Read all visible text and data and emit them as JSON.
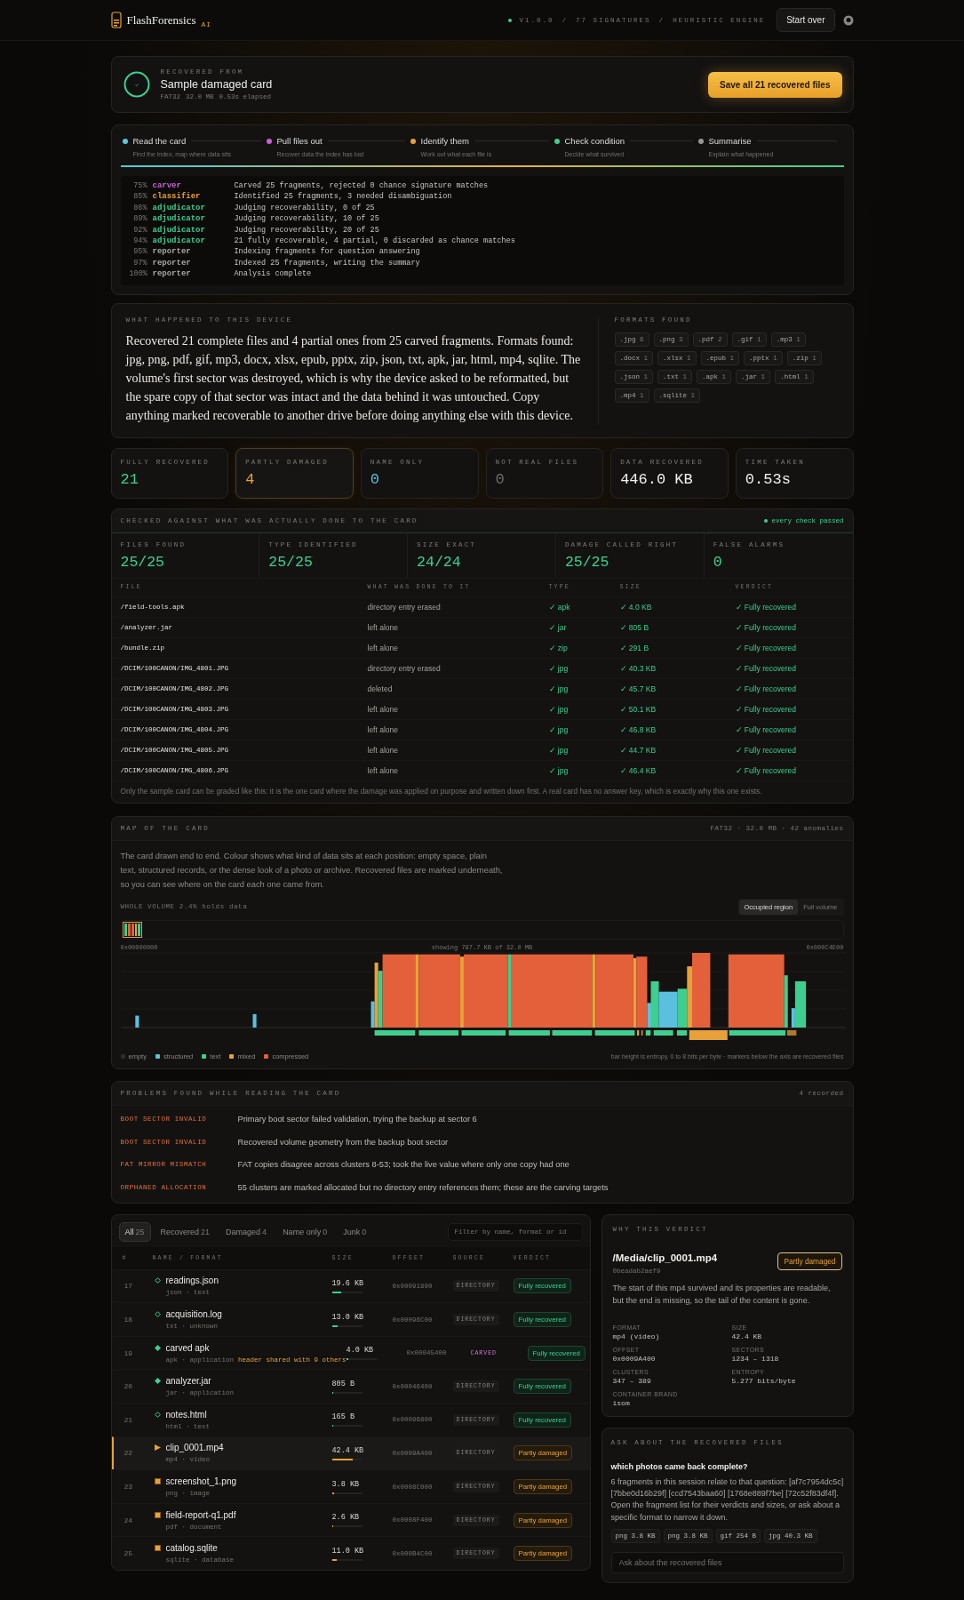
{
  "header": {
    "brand": "FlashForensics",
    "badge": "AI",
    "meta": [
      "V1.0.0",
      "/",
      "77 SIGNATURES",
      "/",
      "HEURISTIC ENGINE"
    ],
    "start_over": "Start over"
  },
  "source": {
    "label": "RECOVERED FROM",
    "name": "Sample damaged card",
    "details": [
      "FAT32",
      "32.0 MB",
      "0.53s elapsed"
    ],
    "save_button": "Save all 21 recovered files"
  },
  "pipeline": {
    "steps": [
      {
        "label": "Read the card",
        "hint": "Find the index, map where data sits",
        "color": "#5bc8e0"
      },
      {
        "label": "Pull files out",
        "hint": "Recover data the index has lost",
        "color": "#c85fd6"
      },
      {
        "label": "Identify them",
        "hint": "Work out what each file is",
        "color": "#e8a13a"
      },
      {
        "label": "Check condition",
        "hint": "Decide what survived",
        "color": "#3ecf8e"
      },
      {
        "label": "Summarise",
        "hint": "Explain what happened",
        "color": "#9a9794"
      }
    ],
    "progress": {
      "level": 1
    },
    "log": [
      {
        "percent": "75%",
        "agent": "carver",
        "message": "Carved 25 fragments, rejected 0 chance signature matches",
        "color": "#c85fd6"
      },
      {
        "percent": "85%",
        "agent": "classifier",
        "message": "Identified 25 fragments, 3 needed disambiguation",
        "color": "#e8a13a"
      },
      {
        "percent": "86%",
        "agent": "adjudicator",
        "message": "Judging recoverability, 0 of 25",
        "color": "#3ecf8e"
      },
      {
        "percent": "89%",
        "agent": "adjudicator",
        "message": "Judging recoverability, 10 of 25",
        "color": "#3ecf8e"
      },
      {
        "percent": "92%",
        "agent": "adjudicator",
        "message": "Judging recoverability, 20 of 25",
        "color": "#3ecf8e"
      },
      {
        "percent": "94%",
        "agent": "adjudicator",
        "message": "21 fully recoverable, 4 partial, 0 discarded as chance matches",
        "color": "#3ecf8e"
      },
      {
        "percent": "95%",
        "agent": "reporter",
        "message": "Indexing fragments for question answering",
        "color": "#a8a5a1"
      },
      {
        "percent": "97%",
        "agent": "reporter",
        "message": "Indexed 25 fragments, writing the summary",
        "color": "#a8a5a1"
      },
      {
        "percent": "100%",
        "agent": "reporter",
        "message": "Analysis complete",
        "color": "#a8a5a1"
      }
    ]
  },
  "summary": {
    "label": "WHAT HAPPENED TO THIS DEVICE",
    "text": "Recovered 21 complete files and 4 partial ones from 25 carved fragments. Formats found: jpg, png, pdf, gif, mp3, docx, xlsx, epub, pptx, zip, json, txt, apk, jar, html, mp4, sqlite. The volume's first sector was destroyed, which is why the device asked to be reformatted, but the spare copy of that sector was intact and the data behind it was untouched. Copy anything marked recoverable to another drive before doing anything else with this device.",
    "formats_label": "FORMATS FOUND",
    "formats": [
      {
        "name": ".jpg",
        "count": "6"
      },
      {
        "name": ".png",
        "count": "3"
      },
      {
        "name": ".pdf",
        "count": "2"
      },
      {
        "name": ".gif",
        "count": "1"
      },
      {
        "name": ".mp3",
        "count": "1"
      },
      {
        "name": ".docx",
        "count": "1"
      },
      {
        "name": ".xlsx",
        "count": "1"
      },
      {
        "name": ".epub",
        "count": "1"
      },
      {
        "name": ".pptx",
        "count": "1"
      },
      {
        "name": ".zip",
        "count": "1"
      },
      {
        "name": ".json",
        "count": "1"
      },
      {
        "name": ".txt",
        "count": "1"
      },
      {
        "name": ".apk",
        "count": "1"
      },
      {
        "name": ".jar",
        "count": "1"
      },
      {
        "name": ".html",
        "count": "1"
      },
      {
        "name": ".mp4",
        "count": "1"
      },
      {
        "name": ".sqlite",
        "count": "1"
      }
    ]
  },
  "stats": [
    {
      "label": "FULLY RECOVERED",
      "value": "21",
      "color": "#3ecf8e",
      "highlighted": false
    },
    {
      "label": "PARTLY DAMAGED",
      "value": "4",
      "color": "#e8a13a",
      "highlighted": true
    },
    {
      "label": "NAME ONLY",
      "value": "0",
      "color": "#5bc0e0",
      "highlighted": false
    },
    {
      "label": "NOT REAL FILES",
      "value": "0",
      "color": "#6f6c69",
      "highlighted": false
    },
    {
      "label": "DATA RECOVERED",
      "value": "446.0 KB",
      "color": "#f2f0ed",
      "highlighted": false
    },
    {
      "label": "TIME TAKEN",
      "value": "0.53s",
      "color": "#f2f0ed",
      "highlighted": false
    }
  ],
  "check": {
    "title": "CHECKED AGAINST WHAT WAS ACTUALLY DONE TO THE CARD",
    "status": "every check passed",
    "metrics": [
      {
        "label": "FILES FOUND",
        "value": "25/25"
      },
      {
        "label": "TYPE IDENTIFIED",
        "value": "25/25"
      },
      {
        "label": "SIZE EXACT",
        "value": "24/24"
      },
      {
        "label": "DAMAGE CALLED RIGHT",
        "value": "25/25"
      },
      {
        "label": "FALSE ALARMS",
        "value": "0"
      }
    ],
    "columns": [
      "FILE",
      "WHAT WAS DONE TO IT",
      "TYPE",
      "SIZE",
      "VERDICT"
    ],
    "rows": [
      {
        "file": "/field-tools.apk",
        "action": "directory entry erased",
        "type": "✓ apk",
        "size": "✓ 4.0 KB",
        "verdict": "✓ Fully recovered"
      },
      {
        "file": "/analyzer.jar",
        "action": "left alone",
        "type": "✓ jar",
        "size": "✓ 805 B",
        "verdict": "✓ Fully recovered"
      },
      {
        "file": "/bundle.zip",
        "action": "left alone",
        "type": "✓ zip",
        "size": "✓ 291 B",
        "verdict": "✓ Fully recovered"
      },
      {
        "file": "/DCIM/100CANON/IMG_4801.JPG",
        "action": "directory entry erased",
        "type": "✓ jpg",
        "size": "✓ 40.3 KB",
        "verdict": "✓ Fully recovered"
      },
      {
        "file": "/DCIM/100CANON/IMG_4802.JPG",
        "action": "deleted",
        "type": "✓ jpg",
        "size": "✓ 45.7 KB",
        "verdict": "✓ Fully recovered"
      },
      {
        "file": "/DCIM/100CANON/IMG_4803.JPG",
        "action": "left alone",
        "type": "✓ jpg",
        "size": "✓ 50.1 KB",
        "verdict": "✓ Fully recovered"
      },
      {
        "file": "/DCIM/100CANON/IMG_4804.JPG",
        "action": "left alone",
        "type": "✓ jpg",
        "size": "✓ 46.8 KB",
        "verdict": "✓ Fully recovered"
      },
      {
        "file": "/DCIM/100CANON/IMG_4805.JPG",
        "action": "left alone",
        "type": "✓ jpg",
        "size": "✓ 44.7 KB",
        "verdict": "✓ Fully recovered"
      },
      {
        "file": "/DCIM/100CANON/IMG_4806.JPG",
        "action": "left alone",
        "type": "✓ jpg",
        "size": "✓ 46.4 KB",
        "verdict": "✓ Fully recovered"
      }
    ],
    "note": "Only the sample card can be graded like this: it is the one card where the damage was applied on purpose and written down first. A real card has no answer key, which is exactly why this one exists."
  },
  "map": {
    "title": "MAP OF THE CARD",
    "meta": "FAT32 · 32.0 MB · 42 anomalies",
    "description": "The card drawn end to end. Colour shows what kind of data sits at each position: empty space, plain text, structured records, or the dense look of a photo or archive. Recovered files are marked underneath, so you can see where on the card each one came from.",
    "overview_label": "WHOLE VOLUME",
    "overview_value": "2.4% holds data",
    "views": [
      {
        "label": "Occupied region",
        "selected": true
      },
      {
        "label": "Full volume",
        "selected": false
      }
    ],
    "start_address": "0x00000000",
    "window": "showing 787.7 KB of 32.0 MB",
    "end_address": "0x000C4E00",
    "legend": [
      {
        "label": "empty",
        "color": "#2e2c2a"
      },
      {
        "label": "structured",
        "color": "#5bc0e0"
      },
      {
        "label": "text",
        "color": "#3ecf8e"
      },
      {
        "label": "mixed",
        "color": "#e8a13a"
      },
      {
        "label": "compressed",
        "color": "#e4603a"
      }
    ],
    "note": "bar height is entropy, 0 to 8 bits per byte · markers below the axis are recovered files"
  },
  "problems": {
    "title": "PROBLEMS FOUND WHILE READING THE CARD",
    "count": "4 recorded",
    "items": [
      {
        "code": "BOOT SECTOR INVALID",
        "message": "Primary boot sector failed validation, trying the backup at sector 6"
      },
      {
        "code": "BOOT SECTOR INVALID",
        "message": "Recovered volume geometry from the backup boot sector"
      },
      {
        "code": "FAT MIRROR MISMATCH",
        "message": "FAT copies disagree across clusters 8-53; took the live value where only one copy had one"
      },
      {
        "code": "ORPHANED ALLOCATION",
        "message": "55 clusters are marked allocated but no directory entry references them; these are the carving targets"
      }
    ]
  },
  "files": {
    "tabs": [
      {
        "label": "All",
        "count": "25",
        "selected": true
      },
      {
        "label": "Recovered",
        "count": "21",
        "selected": false
      },
      {
        "label": "Damaged",
        "count": "4",
        "selected": false
      },
      {
        "label": "Name only",
        "count": "0",
        "selected": false
      },
      {
        "label": "Junk",
        "count": "0",
        "selected": false
      }
    ],
    "filter": {
      "placeholder": "Filter by name, format or id"
    },
    "columns": [
      "#",
      "NAME / FORMAT",
      "SIZE",
      "OFFSET",
      "SOURCE",
      "VERDICT"
    ],
    "rows": [
      {
        "number": "17",
        "marker": {
          "kind": "outline"
        },
        "name": "readings.json",
        "format": "json · text",
        "size": "19.6 KB",
        "level": 0.3,
        "offset": "0x00091800",
        "source": {
          "text": "DIRECTORY",
          "kind": "directory"
        },
        "verdict": {
          "text": "Fully recovered",
          "kind": "full"
        },
        "selected": false
      },
      {
        "number": "18",
        "marker": {
          "kind": "outline"
        },
        "name": "acquisition.log",
        "format": "txt · unknown",
        "size": "13.0 KB",
        "level": 0.2,
        "offset": "0x00096C00",
        "source": {
          "text": "DIRECTORY",
          "kind": "directory"
        },
        "verdict": {
          "text": "Fully recovered",
          "kind": "full"
        },
        "selected": false
      },
      {
        "number": "19",
        "marker": {
          "kind": "filled"
        },
        "name": "carved apk",
        "format": "apk · application",
        "warning": "header shared with 9 others",
        "size": "4.0 KB",
        "level": 0.06,
        "offset": "0x00045400",
        "source": {
          "text": "CARVED",
          "kind": "carved"
        },
        "verdict": {
          "text": "Fully recovered",
          "kind": "full"
        },
        "selected": false
      },
      {
        "number": "20",
        "marker": {
          "kind": "filled"
        },
        "name": "analyzer.jar",
        "format": "jar · application",
        "size": "805 B",
        "level": 0.02,
        "offset": "0x00046400",
        "source": {
          "text": "DIRECTORY",
          "kind": "directory"
        },
        "verdict": {
          "text": "Fully recovered",
          "kind": "full"
        },
        "selected": false
      },
      {
        "number": "21",
        "marker": {
          "kind": "outline"
        },
        "name": "notes.html",
        "format": "html · text",
        "size": "165 B",
        "level": 0.01,
        "offset": "0x00096800",
        "source": {
          "text": "DIRECTORY",
          "kind": "directory"
        },
        "verdict": {
          "text": "Fully recovered",
          "kind": "full"
        },
        "selected": false
      },
      {
        "number": "22",
        "marker": {
          "kind": "play"
        },
        "name": "clip_0001.mp4",
        "format": "mp4 · video",
        "size": "42.4 KB",
        "level": 0.68,
        "offset": "0x0009A400",
        "source": {
          "text": "DIRECTORY",
          "kind": "directory"
        },
        "verdict": {
          "text": "Partly damaged",
          "kind": "partial"
        },
        "selected": true
      },
      {
        "number": "23",
        "marker": {
          "kind": "square"
        },
        "name": "screenshot_1.png",
        "format": "png · image",
        "size": "3.8 KB",
        "level": 0.06,
        "offset": "0x0008C000",
        "source": {
          "text": "DIRECTORY",
          "kind": "directory"
        },
        "verdict": {
          "text": "Partly damaged",
          "kind": "partial"
        },
        "selected": false
      },
      {
        "number": "24",
        "marker": {
          "kind": "square"
        },
        "name": "field-report-q1.pdf",
        "format": "pdf · document",
        "size": "2.6 KB",
        "level": 0.04,
        "offset": "0x0008F400",
        "source": {
          "text": "DIRECTORY",
          "kind": "directory"
        },
        "verdict": {
          "text": "Partly damaged",
          "kind": "partial"
        },
        "selected": false
      },
      {
        "number": "25",
        "marker": {
          "kind": "square"
        },
        "name": "catalog.sqlite",
        "format": "sqlite · database",
        "size": "11.0 KB",
        "level": 0.16,
        "offset": "0x000B4C00",
        "source": {
          "text": "DIRECTORY",
          "kind": "directory"
        },
        "verdict": {
          "text": "Partly damaged",
          "kind": "partial"
        },
        "selected": false
      }
    ]
  },
  "verdict": {
    "title": "WHY THIS VERDICT",
    "path": "/Media/clip_0001.mp4",
    "id": "0beadab2aef9",
    "badge": {
      "text": "Partly damaged",
      "kind": "partial"
    },
    "explanation": "The start of this mp4 survived and its properties are readable, but the end is missing, so the tail of the content is gone.",
    "properties": [
      {
        "label": "FORMAT",
        "value": "mp4 (video)"
      },
      {
        "label": "SIZE",
        "value": "42.4 KB"
      },
      {
        "label": "OFFSET",
        "value": "0x0009A400"
      },
      {
        "label": "SECTORS",
        "value": "1234 – 1318"
      },
      {
        "label": "CLUSTERS",
        "value": "347 – 389"
      },
      {
        "label": "ENTROPY",
        "value": "5.277 bits/byte"
      },
      {
        "label": "CONTAINER BRAND",
        "value": "isom"
      }
    ]
  },
  "ask": {
    "title": "ASK ABOUT THE RECOVERED FILES",
    "question": "which photos came back complete?",
    "answer": "6 fragments in this session relate to that question: [af7c7954dc5c] [7bbe0d16b29f] [ccd7543baa60] [1768e889f7be] [72c52f83df4f]. Open the fragment list for their verdicts and sizes, or ask about a specific format to narrow it down.",
    "chips": [
      "png 3.8 KB",
      "png 3.8 KB",
      "gif 254 B",
      "jpg 40.3 KB"
    ],
    "input": {
      "placeholder": "Ask about the recovered files"
    }
  }
}
